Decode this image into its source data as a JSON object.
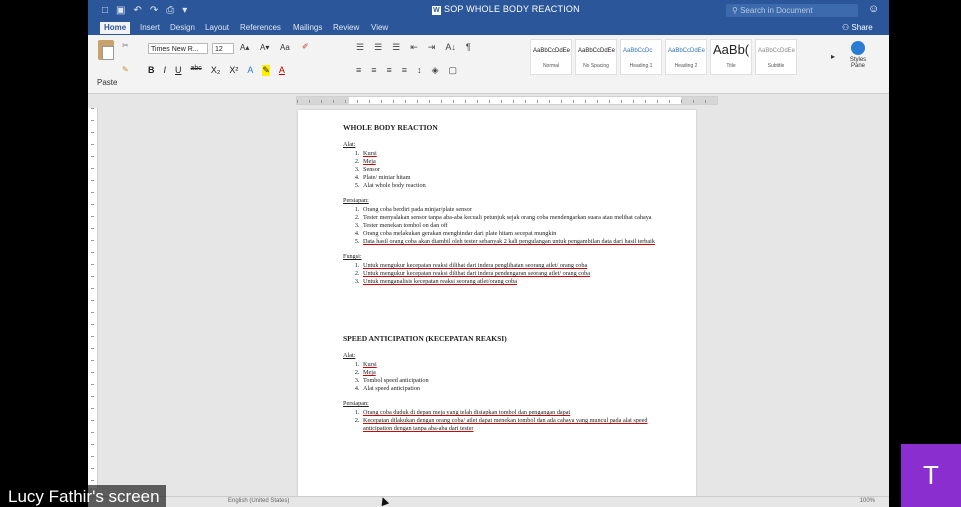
{
  "titlebar": {
    "title": "SOP WHOLE BODY REACTION",
    "search_placeholder": "Search in Document",
    "quick_icons": [
      "□",
      "▣",
      "↶",
      "↷",
      "⎙",
      "▾"
    ],
    "smiley": "☺"
  },
  "tabs": [
    {
      "label": "Home",
      "active": true
    },
    {
      "label": "Insert"
    },
    {
      "label": "Design"
    },
    {
      "label": "Layout"
    },
    {
      "label": "References"
    },
    {
      "label": "Mailings"
    },
    {
      "label": "Review"
    },
    {
      "label": "View"
    }
  ],
  "share_label": "Share",
  "ribbon": {
    "paste_label": "Paste",
    "font_name": "Times New R...",
    "font_size": "12",
    "format_buttons": [
      "B",
      "I",
      "U",
      "abc",
      "X₂",
      "X²",
      "A",
      "A"
    ],
    "paragraph_row1": [
      "☰",
      "☰",
      "☰",
      "⇤",
      "⇥",
      "A↓",
      "¶"
    ],
    "paragraph_row2": [
      "≡",
      "≡",
      "≡",
      "≡",
      "↕",
      "◈",
      "▢"
    ],
    "styles": [
      {
        "sample": "AaBbCcDdEe",
        "name": "Normal"
      },
      {
        "sample": "AaBbCcDdEe",
        "name": "No Spacing"
      },
      {
        "sample": "AaBbCcDc",
        "name": "Heading 1"
      },
      {
        "sample": "AaBbCcDdEe",
        "name": "Heading 2"
      },
      {
        "sample": "AaBb(",
        "name": "Title"
      },
      {
        "sample": "AaBbCcDdEe",
        "name": "Subtitle"
      }
    ],
    "styles_pane_label": "Styles Pane"
  },
  "document": {
    "heading1": "WHOLE BODY REACTION",
    "alat_label": "Alat:",
    "alat_items": [
      "Kursi",
      "Meja",
      "Sensor",
      "Plate/ miniar hitam",
      "Alat whole body reaction"
    ],
    "persiapan_label": "Persiapan:",
    "persiapan_items": [
      "Orang coba berdiri pada minjar/plate sensor",
      "Tester menyalakan sensor tanpa aba-aba kecuali petunjuk sejak orang coba mendengarkan suara atau melihat cahaya",
      "Tester menekan tombol on dan off",
      "Orang coba melakukan gerakan menghindar dari plate hitam secepat mungkin",
      "Data hasil orang coba akan diambil oleh tester sebanyak 2 kali pengulangan untuk pengambilan data dari hasil terbaik"
    ],
    "fungsi_label": "Fungsi:",
    "fungsi_items": [
      "Untuk mengukur kecepatan reaksi dilihat dari indera penglihatan seorang atlet/ orang coba",
      "Untuk mengukur kecepatan reaksi dilihat dari indera pendengaran seorang atlet/ orang coba",
      "Untuk menganalisis kecepatan reaksi seorang atlet/orang coba"
    ],
    "heading2": "SPEED ANTICIPATION (KECEPATAN REAKSI)",
    "alat2_label": "Alat:",
    "alat2_items": [
      "Kursi",
      "Meja",
      "Tombol speed anticipation",
      "Alat speed anticipation"
    ],
    "persiapan2_label": "Persiapan:",
    "persiapan2_items": [
      "Orang coba duduk di depan meja yang telah disiapkan tombol dan pengangan dapat",
      "Kecepatan dilakukan dengan orang coba/ atlet dapat menekan tombol dan ada cahaya yang muncul pada alat speed anticipation dengan tanpa aba-aba dari tester"
    ]
  },
  "statusbar": {
    "language": "English (United States)",
    "zoom": "100%"
  },
  "screen_share_label": "Lucy Fathir's screen",
  "participant_initial": "T",
  "colors": {
    "word_blue": "#2b579a",
    "avatar_purple": "#8a2ed0"
  }
}
